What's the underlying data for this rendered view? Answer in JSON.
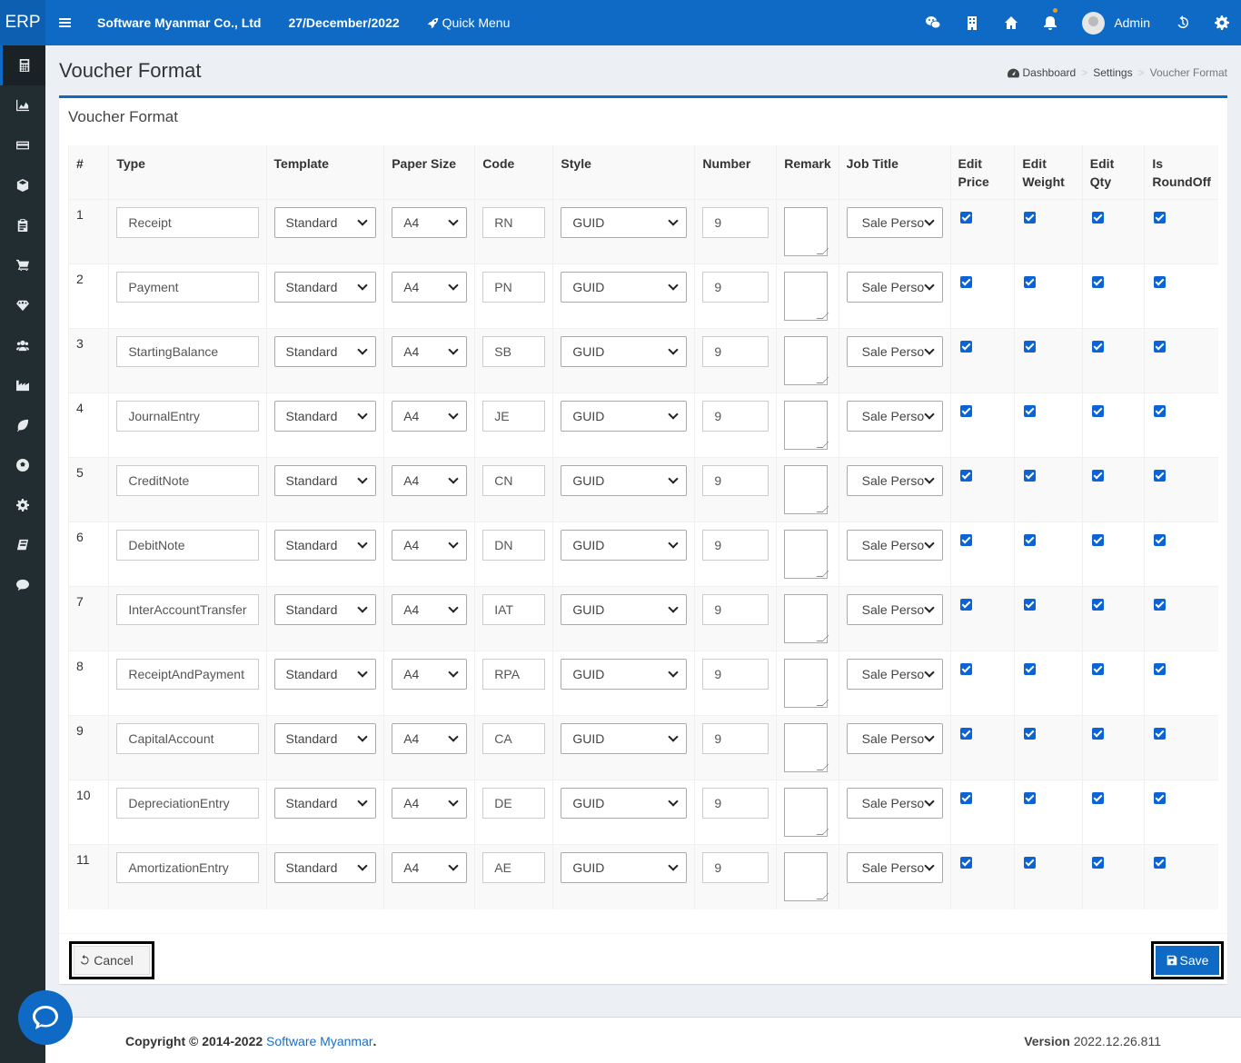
{
  "topbar": {
    "logo": "ERP",
    "company": "Software Myanmar Co., Ltd",
    "date": "27/December/2022",
    "quick_menu": "Quick Menu",
    "user_name": "Admin"
  },
  "page": {
    "title": "Voucher Format",
    "breadcrumb": [
      "Dashboard",
      "Settings",
      "Voucher Format"
    ],
    "box_title": "Voucher Format"
  },
  "table": {
    "headers": [
      "#",
      "Type",
      "Template",
      "Paper Size",
      "Code",
      "Style",
      "Number",
      "Remark",
      "Job Title",
      "Edit Price",
      "Edit Weight",
      "Edit Qty",
      "Is RoundOff"
    ],
    "rows": [
      {
        "num": "1",
        "type": "Receipt",
        "template": "Standard",
        "paper": "A4",
        "code": "RN",
        "style": "GUID",
        "number": "9",
        "job": "Sale Perso"
      },
      {
        "num": "2",
        "type": "Payment",
        "template": "Standard",
        "paper": "A4",
        "code": "PN",
        "style": "GUID",
        "number": "9",
        "job": "Sale Perso"
      },
      {
        "num": "3",
        "type": "StartingBalance",
        "template": "Standard",
        "paper": "A4",
        "code": "SB",
        "style": "GUID",
        "number": "9",
        "job": "Sale Perso"
      },
      {
        "num": "4",
        "type": "JournalEntry",
        "template": "Standard",
        "paper": "A4",
        "code": "JE",
        "style": "GUID",
        "number": "9",
        "job": "Sale Perso"
      },
      {
        "num": "5",
        "type": "CreditNote",
        "template": "Standard",
        "paper": "A4",
        "code": "CN",
        "style": "GUID",
        "number": "9",
        "job": "Sale Perso"
      },
      {
        "num": "6",
        "type": "DebitNote",
        "template": "Standard",
        "paper": "A4",
        "code": "DN",
        "style": "GUID",
        "number": "9",
        "job": "Sale Perso"
      },
      {
        "num": "7",
        "type": "InterAccountTransfer",
        "template": "Standard",
        "paper": "A4",
        "code": "IAT",
        "style": "GUID",
        "number": "9",
        "job": "Sale Perso"
      },
      {
        "num": "8",
        "type": "ReceiptAndPayment",
        "template": "Standard",
        "paper": "A4",
        "code": "RPA",
        "style": "GUID",
        "number": "9",
        "job": "Sale Perso"
      },
      {
        "num": "9",
        "type": "CapitalAccount",
        "template": "Standard",
        "paper": "A4",
        "code": "CA",
        "style": "GUID",
        "number": "9",
        "job": "Sale Perso"
      },
      {
        "num": "10",
        "type": "DepreciationEntry",
        "template": "Standard",
        "paper": "A4",
        "code": "DE",
        "style": "GUID",
        "number": "9",
        "job": "Sale Perso"
      },
      {
        "num": "11",
        "type": "AmortizationEntry",
        "template": "Standard",
        "paper": "A4",
        "code": "AE",
        "style": "GUID",
        "number": "9",
        "job": "Sale Perso"
      }
    ]
  },
  "buttons": {
    "cancel": "Cancel",
    "save": "Save"
  },
  "footer": {
    "copyright": "Copyright © 2014-2022",
    "company_link": "Software Myanmar",
    "period": ".",
    "version_label": "Version",
    "version": "2022.12.26.811"
  },
  "colors": {
    "primary": "#0e6ac4",
    "sidebar": "#222d32",
    "checkbox": "#0b63d6"
  }
}
